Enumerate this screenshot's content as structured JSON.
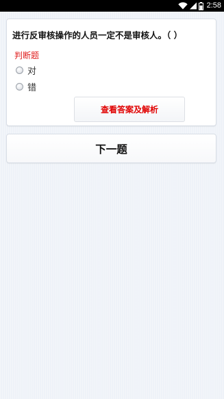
{
  "status_bar": {
    "time": "2:58",
    "icons": [
      "wifi-icon",
      "cellular-signal-icon",
      "battery-icon"
    ]
  },
  "question": {
    "text": "进行反审核操作的人员一定不是审核人。（  ）",
    "type": "判断题",
    "options": [
      {
        "label": "对"
      },
      {
        "label": "错"
      }
    ],
    "show_answer_label": "查看答案及解析"
  },
  "next_button": {
    "label": "下一题"
  },
  "colors": {
    "accent_red": "#e00000",
    "page_background": "#eef2f8"
  }
}
